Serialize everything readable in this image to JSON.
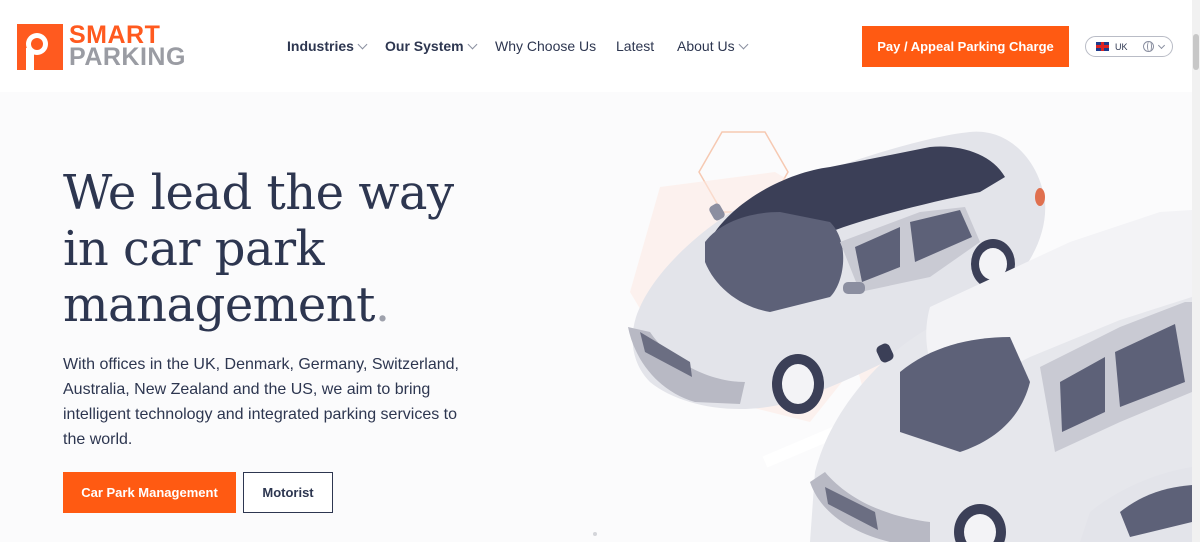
{
  "brand": {
    "line1": "SMART",
    "line2": "PARKING",
    "accent": "#ff5a1f",
    "secondary": "#9a9ca3"
  },
  "nav": {
    "items": [
      {
        "label": "Industries",
        "has_dropdown": true,
        "bold": true
      },
      {
        "label": "Our System",
        "has_dropdown": true,
        "bold": true
      },
      {
        "label": "Why Choose Us",
        "has_dropdown": false,
        "bold": false
      },
      {
        "label": "Latest",
        "has_dropdown": false,
        "bold": false
      },
      {
        "label": "About Us",
        "has_dropdown": true,
        "bold": false
      }
    ]
  },
  "header": {
    "pay_button": "Pay / Appeal Parking Charge",
    "language": {
      "label": "UK",
      "flag_icon": "uk-flag-icon",
      "globe_icon": "globe-icon"
    }
  },
  "hero": {
    "headline": "We lead the way in car park management",
    "headline_dot": ".",
    "intro": "With offices in the UK, Denmark, Germany, Switzerland, Australia, New Zealand and the US, we aim to bring intelligent technology and integrated parking services to the world.",
    "primary_button": "Car Park Management",
    "secondary_button": "Motorist",
    "illustration": "car-park-illustration"
  },
  "colors": {
    "text": "#2d3650",
    "orange": "#ff5a12",
    "hero_bg": "#fbfbfc"
  }
}
